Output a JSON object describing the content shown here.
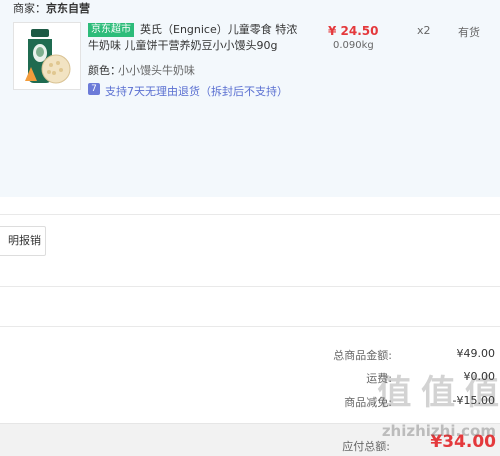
{
  "order": {
    "seller_prefix": "商家：",
    "seller_name": "京东自营",
    "product": {
      "badge": "京东超市",
      "title_line1": "英氏（Engnice）儿童零食 特浓",
      "title_line2": "牛奶味 儿童饼干营养奶豆小小馒头90g",
      "color_label": "颜色：",
      "color_value": "小小馒头牛奶味",
      "return_icon": "7",
      "return_text": "支持7天无理由退货（拆封后不支持）",
      "price": "¥ 24.50",
      "weight": "0.090kg",
      "quantity": "x2",
      "stock": "有货"
    },
    "invoice_button": "明报销",
    "totals": {
      "goods_label": "总商品金额:",
      "goods_value": "¥49.00",
      "shipping_label": "运费:",
      "shipping_value": "¥0.00",
      "discount_label": "商品减免:",
      "discount_value": "-¥15.00"
    },
    "payable_label": "应付总额:",
    "payable_value": "¥34.00",
    "watermark": "值 值 值",
    "watermark_url": "zhizhizhi.com"
  },
  "colors": {
    "card_bg": "#f3f8fc",
    "price_red": "#e4393c",
    "badge_green": "#2dbc7a",
    "return_blue": "#5a6fd1"
  }
}
